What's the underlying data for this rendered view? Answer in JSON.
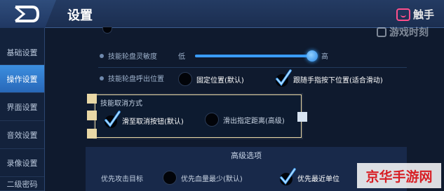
{
  "header": {
    "title": "设置",
    "brand_label": "触手",
    "watermark_label": "游戏时刻"
  },
  "sidebar": {
    "items": [
      {
        "label": "基础设置",
        "active": false
      },
      {
        "label": "操作设置",
        "active": true
      },
      {
        "label": "界面设置",
        "active": false
      },
      {
        "label": "音效设置",
        "active": false
      },
      {
        "label": "录像设置",
        "active": false
      },
      {
        "label": "二级密码",
        "active": false
      }
    ]
  },
  "skill_sensitivity": {
    "label": "技能轮盘灵敏度",
    "low_label": "低",
    "high_label": "高",
    "value_fraction": 0.98
  },
  "skill_position": {
    "label": "技能轮盘呼出位置",
    "options": [
      {
        "label": "固定位置(默认)",
        "selected": false
      },
      {
        "label": "跟随手指按下位置(适合滑动)",
        "selected": true
      }
    ]
  },
  "skill_cancel": {
    "label": "技能取消方式",
    "options": [
      {
        "label": "滑至取消按钮(默认)",
        "selected": true
      },
      {
        "label": "滑出指定距离(高级)",
        "selected": false
      }
    ]
  },
  "advanced": {
    "title": "高级选项",
    "priority_label": "优先攻击目标",
    "options": [
      {
        "label": "优先血量最少(默认)",
        "selected": false
      },
      {
        "label": "优先最近单位",
        "selected": true
      }
    ]
  },
  "watermark_bottom": "京华手游网",
  "colors": {
    "accent": "#3a9cff",
    "active_tab": "#2f7cd0",
    "highlight_border": "#e9d8a6"
  }
}
